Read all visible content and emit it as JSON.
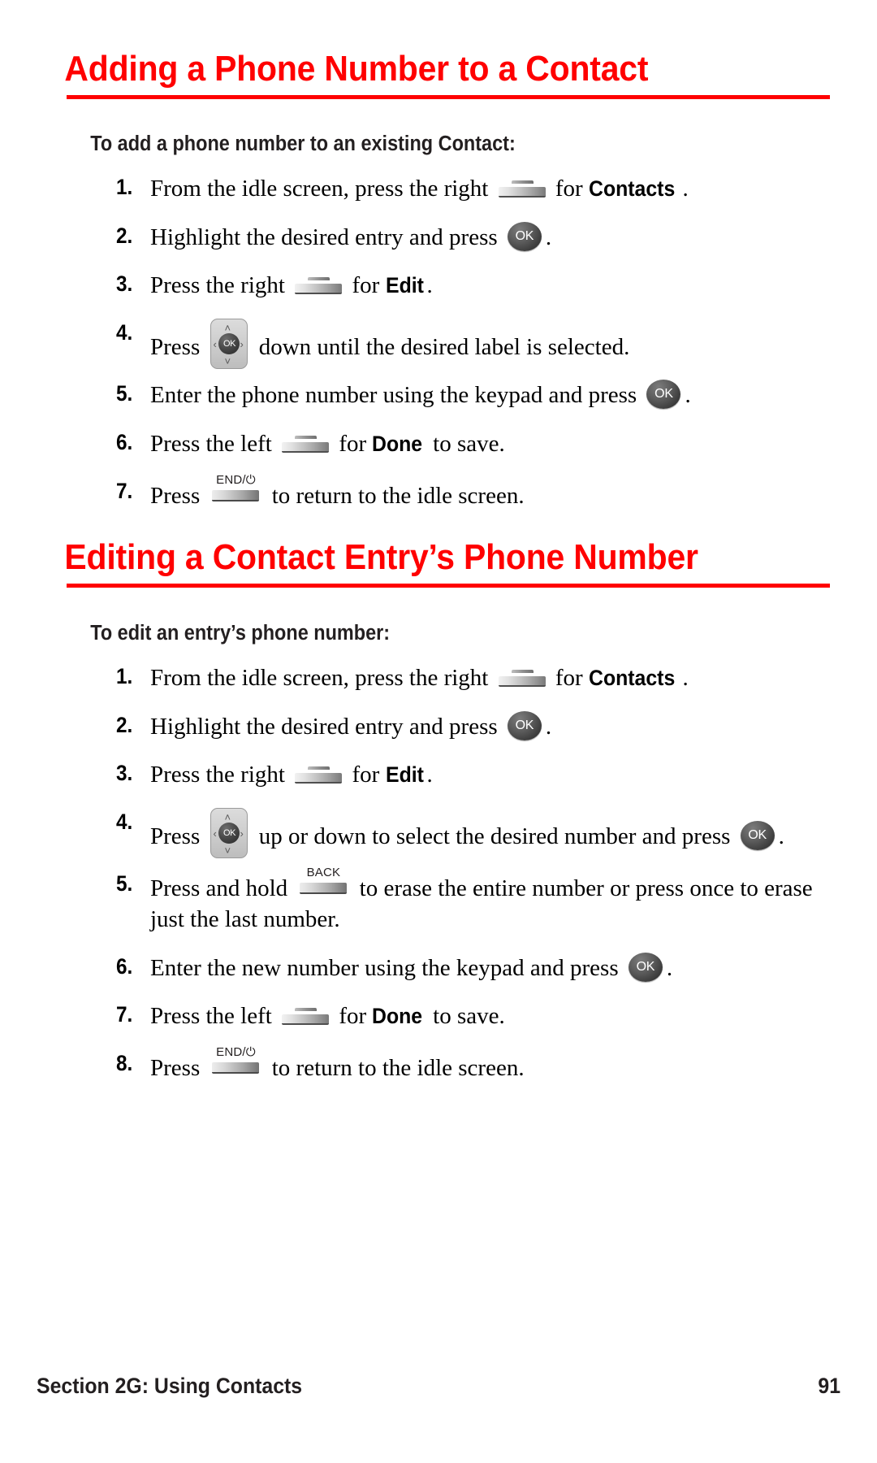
{
  "document": {
    "page_number": "91",
    "footer_text": "Section 2G: Using Contacts",
    "accent_color": "#ff0000",
    "text_color": "#000000"
  },
  "icons": {
    "softkey": "softkey-icon",
    "ok_key": "ok-key-icon",
    "nav_key": "navigation-key-icon",
    "end_key": "end-power-key-icon",
    "back_key": "back-key-icon",
    "ok_label": "OK",
    "end_label": "END/⏻",
    "back_label": "BACK",
    "nav_up": "˄",
    "nav_down": "˅",
    "nav_left": "‹",
    "nav_right": "›"
  },
  "sections": [
    {
      "heading": "Adding a Phone Number to a Contact",
      "subheading": "To add a phone number to an existing Contact:",
      "steps": [
        {
          "number": "1.",
          "parts": [
            {
              "t": "text",
              "v": "From the idle screen, press the right "
            },
            {
              "t": "key",
              "v": "softkey"
            },
            {
              "t": "text",
              "v": " for "
            },
            {
              "t": "bold",
              "v": "Contacts"
            },
            {
              "t": "text",
              "v": "."
            }
          ]
        },
        {
          "number": "2.",
          "parts": [
            {
              "t": "text",
              "v": "Highlight the desired entry and press "
            },
            {
              "t": "key",
              "v": "ok"
            },
            {
              "t": "text",
              "v": "."
            }
          ]
        },
        {
          "number": "3.",
          "parts": [
            {
              "t": "text",
              "v": "Press the right "
            },
            {
              "t": "key",
              "v": "softkey"
            },
            {
              "t": "text",
              "v": " for "
            },
            {
              "t": "bold",
              "v": "Edit"
            },
            {
              "t": "text",
              "v": "."
            }
          ]
        },
        {
          "number": "4.",
          "parts": [
            {
              "t": "text",
              "v": "Press "
            },
            {
              "t": "key",
              "v": "nav"
            },
            {
              "t": "text",
              "v": " down until the desired label is selected."
            }
          ]
        },
        {
          "number": "5.",
          "parts": [
            {
              "t": "text",
              "v": "Enter the phone number using the keypad and press "
            },
            {
              "t": "key",
              "v": "ok"
            },
            {
              "t": "text",
              "v": "."
            }
          ]
        },
        {
          "number": "6.",
          "parts": [
            {
              "t": "text",
              "v": "Press the left "
            },
            {
              "t": "key",
              "v": "softkey"
            },
            {
              "t": "text",
              "v": " for "
            },
            {
              "t": "bold",
              "v": "Done"
            },
            {
              "t": "text",
              "v": " to save."
            }
          ]
        },
        {
          "number": "7.",
          "parts": [
            {
              "t": "text",
              "v": "Press "
            },
            {
              "t": "key",
              "v": "end"
            },
            {
              "t": "text",
              "v": " to return to the idle screen."
            }
          ]
        }
      ]
    },
    {
      "heading": "Editing a Contact Entry’s Phone Number",
      "subheading": "To edit an entry’s phone number:",
      "steps": [
        {
          "number": "1.",
          "parts": [
            {
              "t": "text",
              "v": "From the idle screen, press the right "
            },
            {
              "t": "key",
              "v": "softkey"
            },
            {
              "t": "text",
              "v": " for "
            },
            {
              "t": "bold",
              "v": "Contacts"
            },
            {
              "t": "text",
              "v": "."
            }
          ]
        },
        {
          "number": "2.",
          "parts": [
            {
              "t": "text",
              "v": "Highlight the desired entry and press "
            },
            {
              "t": "key",
              "v": "ok"
            },
            {
              "t": "text",
              "v": "."
            }
          ]
        },
        {
          "number": "3.",
          "parts": [
            {
              "t": "text",
              "v": "Press the right "
            },
            {
              "t": "key",
              "v": "softkey"
            },
            {
              "t": "text",
              "v": " for "
            },
            {
              "t": "bold",
              "v": "Edit"
            },
            {
              "t": "text",
              "v": "."
            }
          ]
        },
        {
          "number": "4.",
          "parts": [
            {
              "t": "text",
              "v": "Press "
            },
            {
              "t": "key",
              "v": "nav"
            },
            {
              "t": "text",
              "v": " up or down to select the desired number and press "
            },
            {
              "t": "key",
              "v": "ok"
            },
            {
              "t": "text",
              "v": "."
            }
          ]
        },
        {
          "number": "5.",
          "parts": [
            {
              "t": "text",
              "v": "Press and hold "
            },
            {
              "t": "key",
              "v": "back"
            },
            {
              "t": "text",
              "v": " to erase the entire number or press once to erase just the last number."
            }
          ]
        },
        {
          "number": "6.",
          "parts": [
            {
              "t": "text",
              "v": "Enter the new number using the keypad and press "
            },
            {
              "t": "key",
              "v": "ok"
            },
            {
              "t": "text",
              "v": "."
            }
          ]
        },
        {
          "number": "7.",
          "parts": [
            {
              "t": "text",
              "v": "Press the left "
            },
            {
              "t": "key",
              "v": "softkey"
            },
            {
              "t": "text",
              "v": " for "
            },
            {
              "t": "bold",
              "v": "Done"
            },
            {
              "t": "text",
              "v": " to save."
            }
          ]
        },
        {
          "number": "8.",
          "parts": [
            {
              "t": "text",
              "v": "Press "
            },
            {
              "t": "key",
              "v": "end"
            },
            {
              "t": "text",
              "v": " to return to the idle screen."
            }
          ]
        }
      ]
    }
  ]
}
